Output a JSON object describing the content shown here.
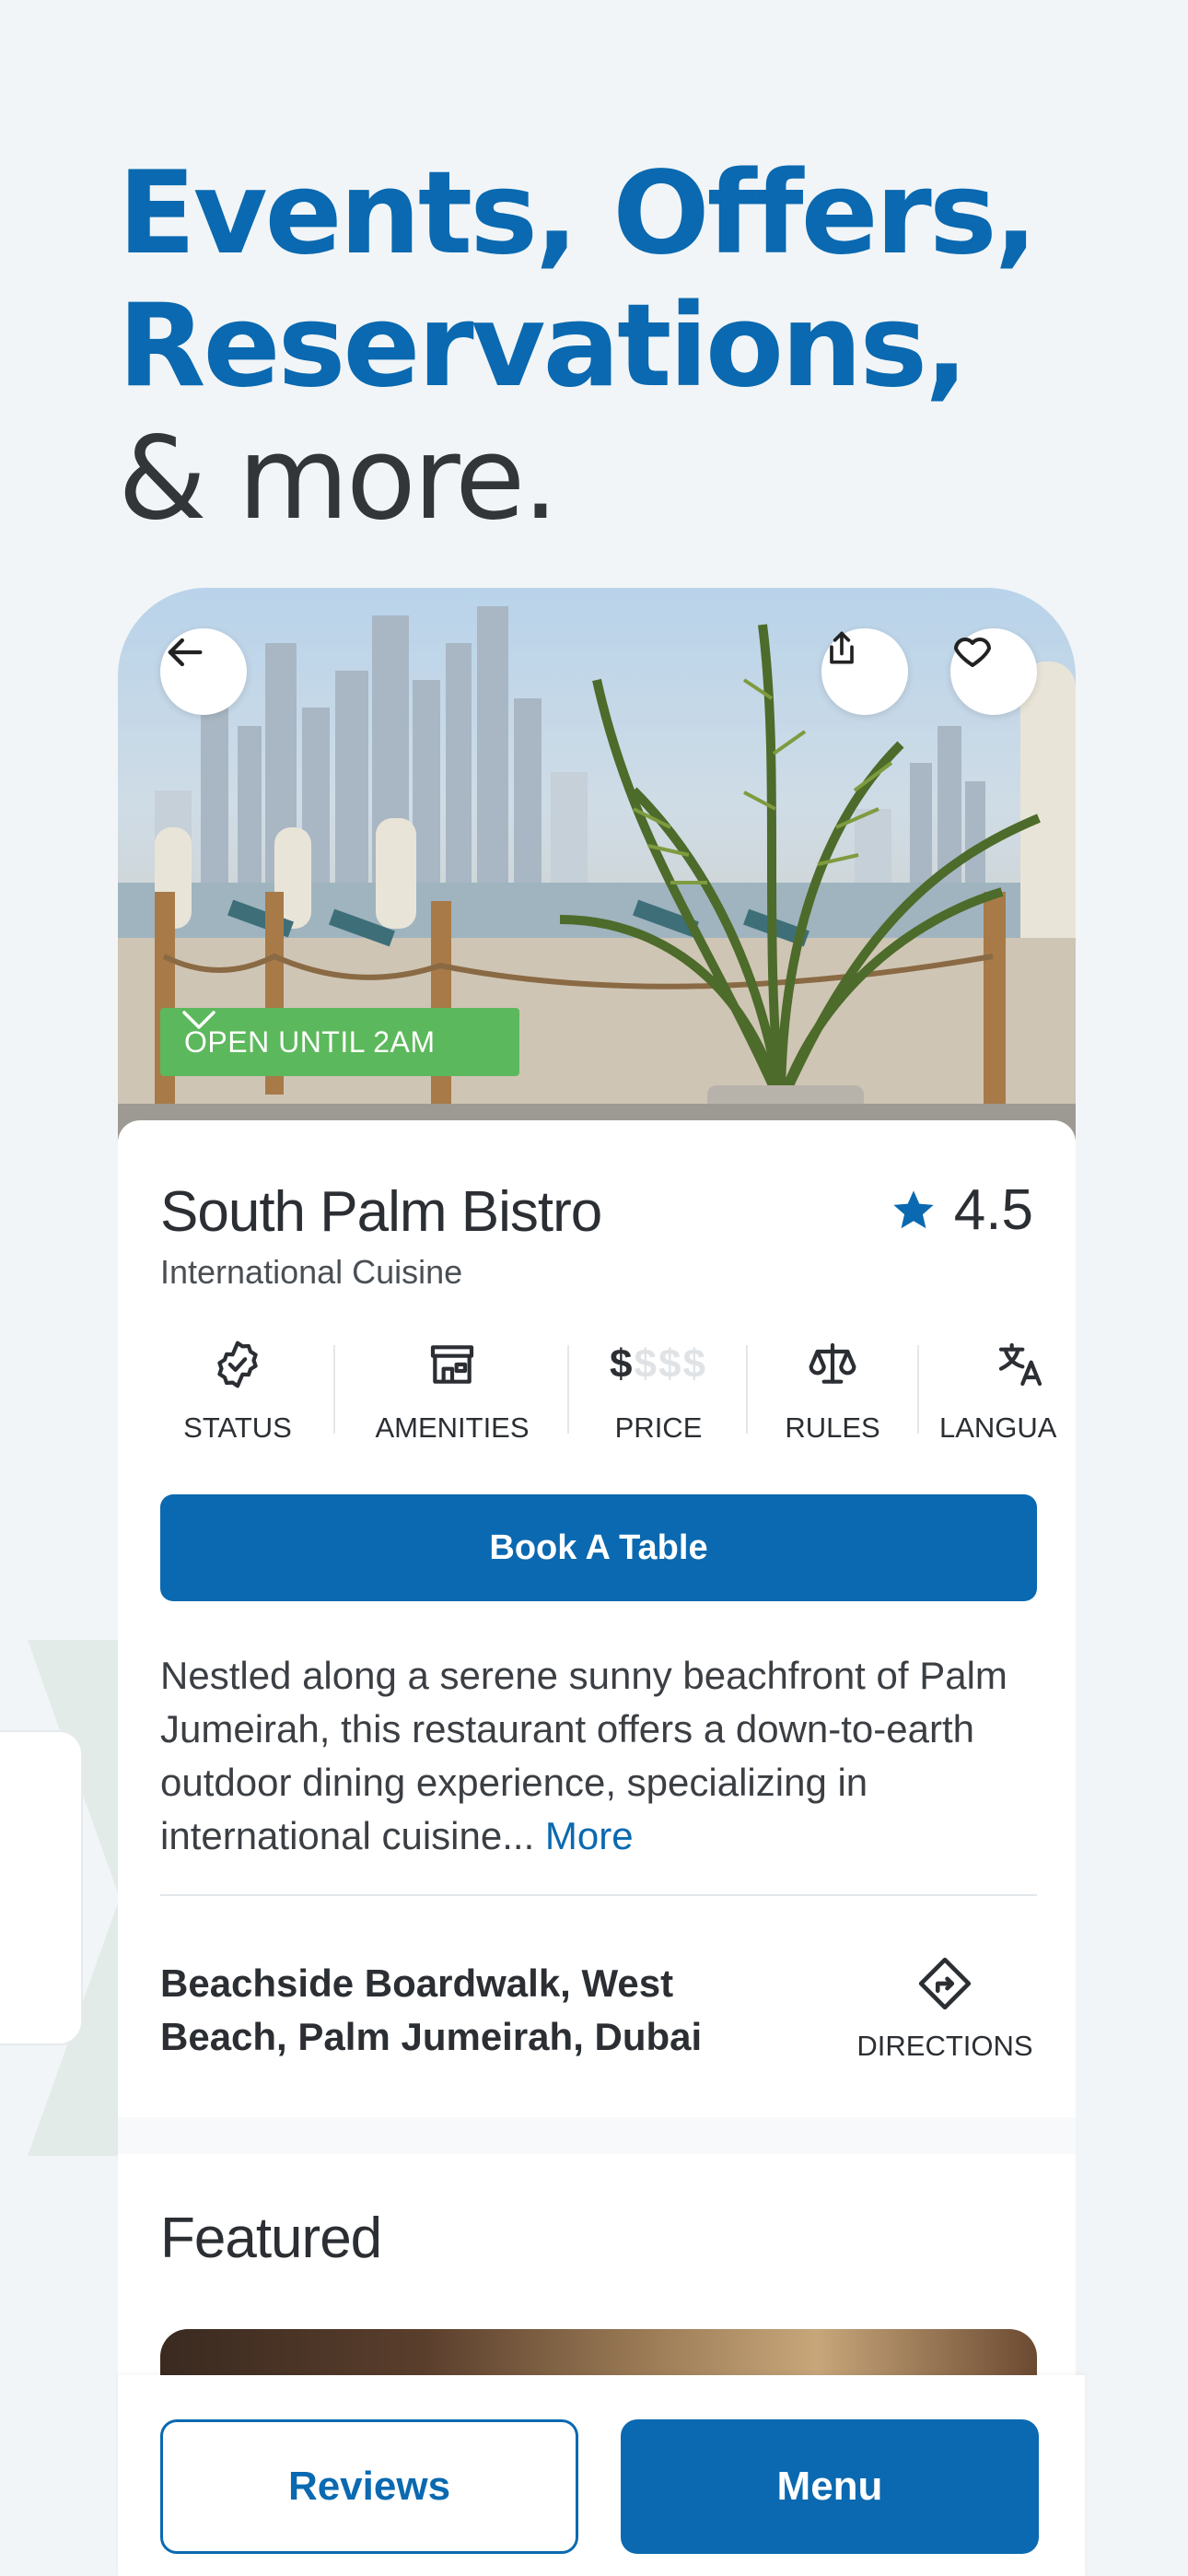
{
  "headline": {
    "line1": "Events, Offers,",
    "line2": "Reservations,",
    "line3": "& more."
  },
  "venue": {
    "open_badge": "OPEN UNTIL 2AM",
    "name": "South Palm Bistro",
    "rating": "4.5",
    "cuisine": "International Cuisine",
    "attributes": [
      {
        "label": "STATUS",
        "icon": "verified-badge-icon"
      },
      {
        "label": "AMENITIES",
        "icon": "storefront-icon"
      },
      {
        "label": "PRICE",
        "icon": "price-level-icon",
        "price_active": "$",
        "price_inactive": "$$$"
      },
      {
        "label": "RULES",
        "icon": "scales-icon"
      },
      {
        "label": "LANGUA",
        "icon": "translate-icon"
      }
    ],
    "book_label": "Book A Table",
    "description": "Nestled along a serene sunny beachfront of Palm Jumeirah, this restaurant offers a down-to-earth outdoor dining experience, specializing in international cuisine...",
    "more_label": "More",
    "address_line1": "Beachside Boardwalk, West",
    "address_line2": "Beach, Palm Jumeirah, Dubai",
    "directions_label": "DIRECTIONS",
    "featured_title": "Featured"
  },
  "bottom_bar": {
    "reviews_label": "Reviews",
    "menu_label": "Menu"
  },
  "colors": {
    "brand_blue": "#0a69b0",
    "open_green": "#5cb85c",
    "background": "#f1f5f7"
  }
}
